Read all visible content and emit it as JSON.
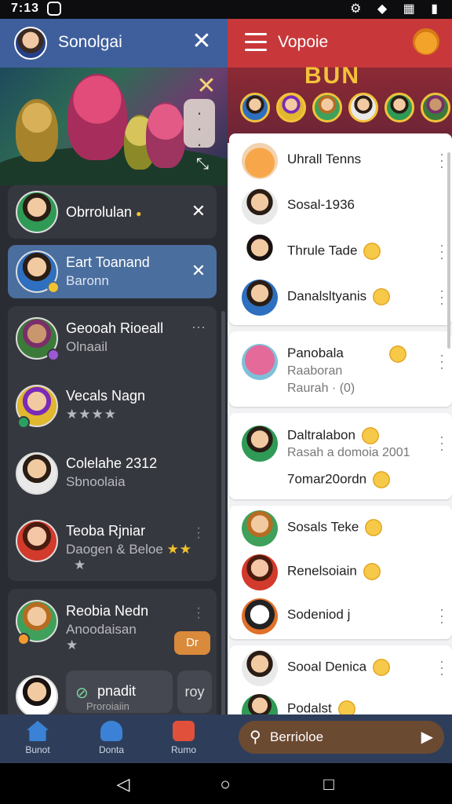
{
  "status": {
    "time": "7:13"
  },
  "left": {
    "header": {
      "title": "Sonolgai",
      "close_label": "✕"
    },
    "pinned": [
      {
        "name": "Obrrolulan",
        "emoji": "🟡"
      },
      {
        "name": "Eart Toanand",
        "sub": "Baronn"
      }
    ],
    "chats": [
      {
        "name": "Geooah Rioeall",
        "sub": "Olnaail"
      },
      {
        "name": "Vecals Nagn",
        "stars": "★★★★"
      },
      {
        "name": "Colelahe 2312",
        "sub": "Sbnoolaia"
      },
      {
        "name": "Teoba Rjniar",
        "sub": "Daogen & Beloe",
        "stars": "★★"
      },
      {
        "name": "Reobia Nedn",
        "sub": "Anoodaisan"
      }
    ],
    "bottom_chips": [
      {
        "label": "pnadit"
      },
      {
        "label": "Proroiaiin"
      },
      {
        "label": "roy"
      }
    ],
    "action_chip": "Dr"
  },
  "nav": [
    {
      "label": "Bunot",
      "color": "#3b82d6"
    },
    {
      "label": "Donta",
      "color": "#3b82d6"
    },
    {
      "label": "Rumo",
      "color": "#e0503a"
    }
  ],
  "right": {
    "header": {
      "title": "Vopoie"
    },
    "banner_text": "BUN",
    "contacts": [
      {
        "name": "Uhrall Tenns"
      },
      {
        "name": "Sosal-1936"
      },
      {
        "name": "Thrule Tade"
      },
      {
        "name": "Danalsltyanis"
      }
    ],
    "group2": {
      "name": "Panobala",
      "sub1": "Raaboran",
      "sub2": "Raurah · (0)"
    },
    "group3": {
      "name": "Daltralabon",
      "sub1": "Rasah a domoia 2001",
      "sub2": "7omar20ordn"
    },
    "group4": [
      {
        "name": "Sosals Teke"
      },
      {
        "name": "Renelsoiain"
      },
      {
        "name": "Sodeniod j"
      }
    ],
    "group5": [
      {
        "name": "Sooal Denica"
      },
      {
        "name": "Podalst"
      }
    ],
    "search_placeholder": "Berrioloe"
  }
}
